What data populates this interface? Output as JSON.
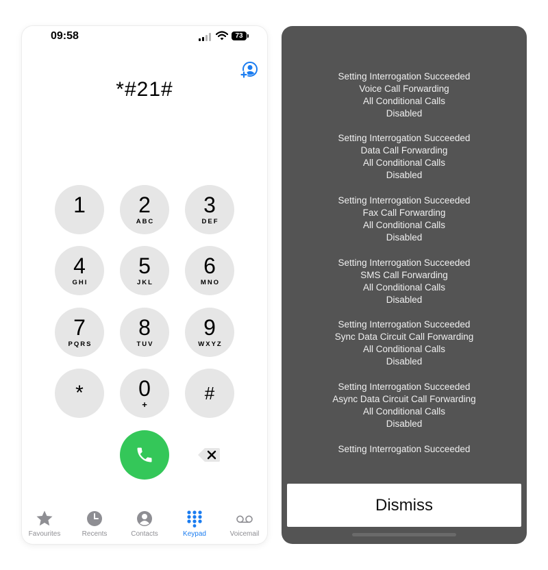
{
  "status_bar": {
    "time": "09:58",
    "battery": "73"
  },
  "dialer": {
    "number": "*#21#",
    "keys": [
      {
        "digit": "1",
        "letters": ""
      },
      {
        "digit": "2",
        "letters": "ABC"
      },
      {
        "digit": "3",
        "letters": "DEF"
      },
      {
        "digit": "4",
        "letters": "GHI"
      },
      {
        "digit": "5",
        "letters": "JKL"
      },
      {
        "digit": "6",
        "letters": "MNO"
      },
      {
        "digit": "7",
        "letters": "PQRS"
      },
      {
        "digit": "8",
        "letters": "TUV"
      },
      {
        "digit": "9",
        "letters": "WXYZ"
      },
      {
        "digit": "*",
        "letters": ""
      },
      {
        "digit": "0",
        "letters": "+"
      },
      {
        "digit": "#",
        "letters": ""
      }
    ]
  },
  "tabs": [
    {
      "label": "Favourites",
      "icon": "star-icon"
    },
    {
      "label": "Recents",
      "icon": "clock-icon"
    },
    {
      "label": "Contacts",
      "icon": "person-icon"
    },
    {
      "label": "Keypad",
      "icon": "keypad-icon"
    },
    {
      "label": "Voicemail",
      "icon": "voicemail-icon"
    }
  ],
  "colors": {
    "call_green": "#34c759",
    "active_blue": "#1a7cf0",
    "key_gray": "#e6e6e6",
    "overlay_gray": "#545454"
  },
  "results": [
    {
      "lines": [
        "Setting Interrogation Succeeded",
        "Voice Call Forwarding",
        "All Conditional Calls",
        "Disabled"
      ]
    },
    {
      "lines": [
        "Setting Interrogation Succeeded",
        "Data Call Forwarding",
        "All Conditional Calls",
        "Disabled"
      ]
    },
    {
      "lines": [
        "Setting Interrogation Succeeded",
        "Fax Call Forwarding",
        "All Conditional Calls",
        "Disabled"
      ]
    },
    {
      "lines": [
        "Setting Interrogation Succeeded",
        "SMS Call Forwarding",
        "All Conditional Calls",
        "Disabled"
      ]
    },
    {
      "lines": [
        "Setting Interrogation Succeeded",
        "Sync Data Circuit Call Forwarding",
        "All Conditional Calls",
        "Disabled"
      ]
    },
    {
      "lines": [
        "Setting Interrogation Succeeded",
        "Async Data Circuit Call Forwarding",
        "All Conditional Calls",
        "Disabled"
      ]
    },
    {
      "lines": [
        "Setting Interrogation Succeeded"
      ]
    }
  ],
  "dismiss_label": "Dismiss"
}
